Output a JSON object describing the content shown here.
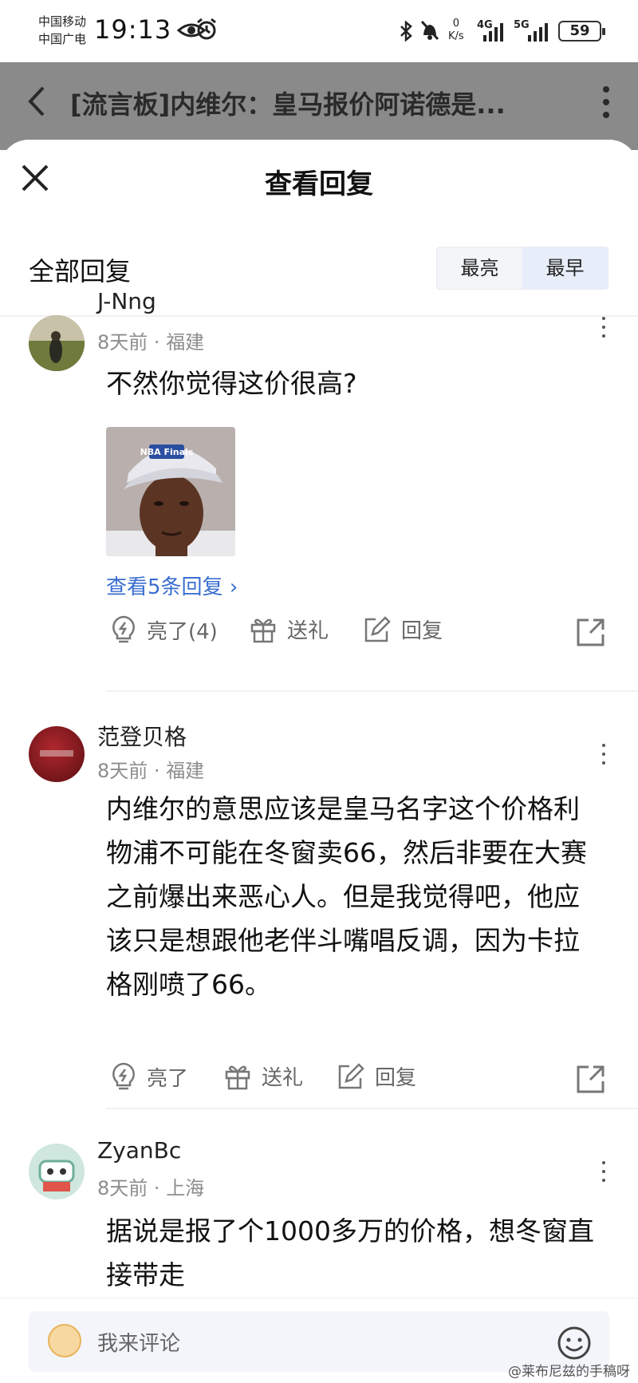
{
  "status_bar": {
    "carrier_1": "中国移动",
    "carrier_2": "中国广电",
    "time": "19:13",
    "net_speed_value": "0",
    "net_speed_unit": "K/s",
    "signal_1": "4G",
    "signal_2": "5G",
    "battery": "59"
  },
  "app_header": {
    "title": "[流言板]内维尔：皇马报价阿诺德是..."
  },
  "sheet": {
    "title": "查看回复",
    "section_title": "全部回复",
    "sort_options": [
      "最亮",
      "最早"
    ],
    "active_sort": "最早"
  },
  "comments": [
    {
      "username": "J-Nng",
      "time": "8天前",
      "location": "福建",
      "text": "不然你觉得这价很高?",
      "image_caption": "NBA Finals",
      "view_replies": "查看5条回复",
      "actions": {
        "like": "亮了(4)",
        "gift": "送礼",
        "reply": "回复"
      }
    },
    {
      "username": "范登贝格",
      "time": "8天前",
      "location": "福建",
      "text": "内维尔的意思应该是皇马名字这个价格利物浦不可能在冬窗卖66，然后非要在大赛之前爆出来恶心人。但是我觉得吧，他应该只是想跟他老伴斗嘴唱反调，因为卡拉格刚喷了66。",
      "actions": {
        "like": "亮了",
        "gift": "送礼",
        "reply": "回复"
      }
    },
    {
      "username": "ZyanBc",
      "time": "8天前",
      "location": "上海",
      "text": "据说是报了个1000多万的价格，想冬窗直接带走"
    }
  ],
  "bottom_bar": {
    "placeholder": "我来评论",
    "watermark": "@莱布尼兹的手稿呀"
  },
  "colors": {
    "link": "#3a6fd0",
    "header_dim": "#8a8a8a",
    "meta_text": "#8d8d8d"
  }
}
